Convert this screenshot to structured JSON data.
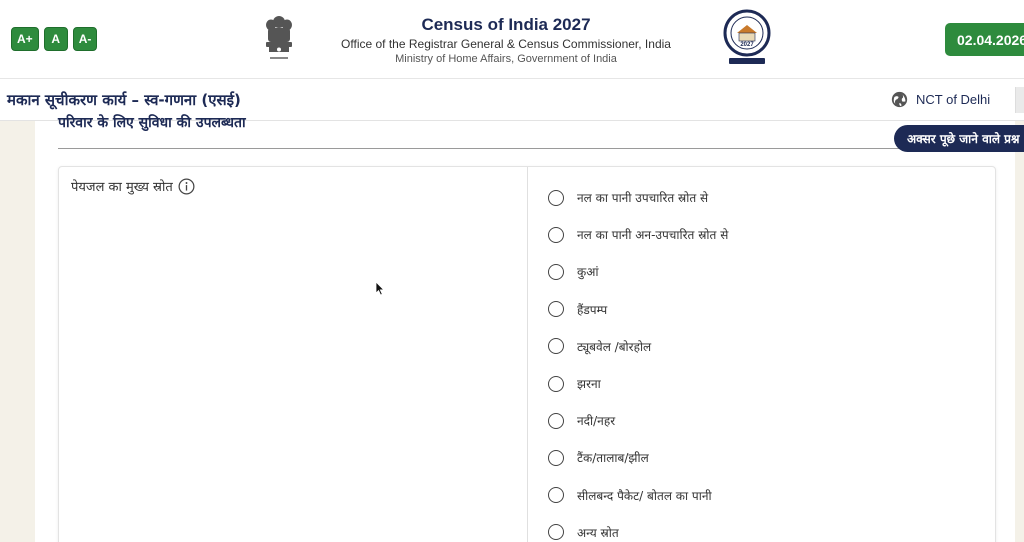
{
  "header": {
    "font_controls": [
      "A+",
      "A",
      "A-"
    ],
    "title": "Census of India 2027",
    "subtitle": "Office of the Registrar General & Census Commissioner, India",
    "ministry": "Ministry of Home Affairs, Government of India",
    "date": "02.04.2026",
    "emblem_icon": "national-emblem-icon",
    "logo_icon": "census-logo-icon"
  },
  "subheader": {
    "module_title": "मकान सूचीकरण कार्य – स्व-गणना (एसई)",
    "region_icon": "globe-icon",
    "region": "NCT of Delhi"
  },
  "section": {
    "title": "परिवार के लिए सुविधा की उपलब्धता",
    "faq_label": "अक्सर पूछे जाने वाले प्रश्न"
  },
  "question": {
    "label": "पेयजल का मुख्य स्रोत",
    "info_icon": "info-icon",
    "options": [
      "नल का पानी उपचारित स्रोत से",
      "नल का पानी अन-उपचारित स्रोत से",
      "कुआं",
      "हैंडपम्प",
      "ट्यूबवेल /बोरहोल",
      "झरना",
      "नदी/नहर",
      "टैंक/तालाब/झील",
      "सीलबन्द पैकेट/ बोतल का पानी",
      "अन्य स्रोत"
    ]
  },
  "colors": {
    "navy": "#1d2a55",
    "green": "#2e8b3d",
    "page_bg": "#f4f1e8"
  }
}
